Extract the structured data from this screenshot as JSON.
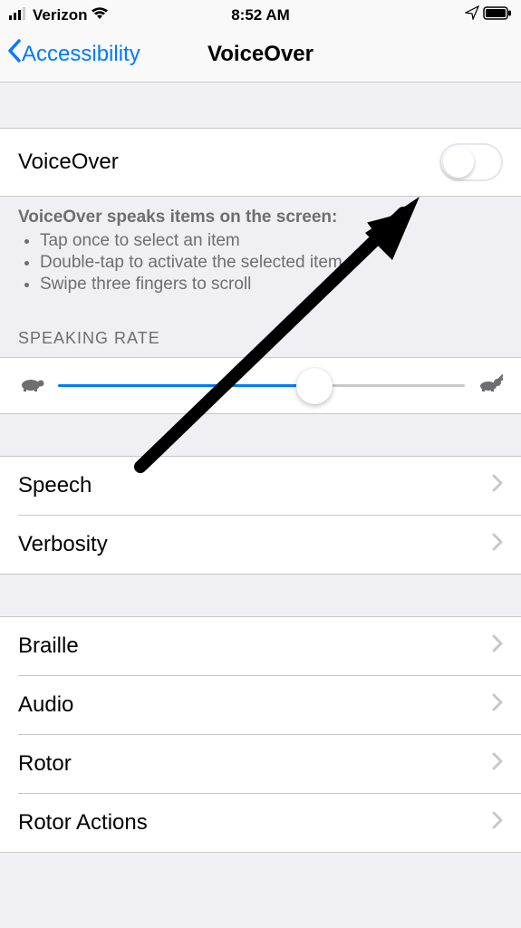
{
  "status": {
    "carrier": "Verizon",
    "time": "8:52 AM"
  },
  "nav": {
    "back_label": "Accessibility",
    "title": "VoiceOver"
  },
  "toggle": {
    "label": "VoiceOver",
    "enabled": false
  },
  "footer": {
    "heading": "VoiceOver speaks items on the screen:",
    "bullets": [
      "Tap once to select an item",
      "Double-tap to activate the selected item",
      "Swipe three fingers to scroll"
    ]
  },
  "rate": {
    "header": "Speaking Rate",
    "value_percent": 63
  },
  "groups": [
    {
      "items": [
        {
          "label": "Speech"
        },
        {
          "label": "Verbosity"
        }
      ]
    },
    {
      "items": [
        {
          "label": "Braille"
        },
        {
          "label": "Audio"
        },
        {
          "label": "Rotor"
        },
        {
          "label": "Rotor Actions"
        }
      ]
    }
  ]
}
